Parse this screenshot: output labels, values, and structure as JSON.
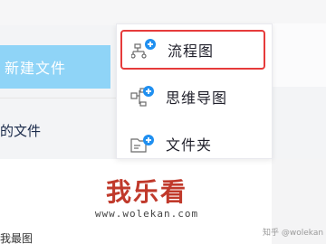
{
  "sidebar": {
    "new_file_label": "新建文件",
    "item_label": "的文件",
    "bottom_fragment": "我最图"
  },
  "dropdown": {
    "items": [
      {
        "label": "流程图",
        "icon": "flowchart-add-icon",
        "selected": true
      },
      {
        "label": "思维导图",
        "icon": "mindmap-add-icon",
        "selected": false
      },
      {
        "label": "文件夹",
        "icon": "folder-add-icon",
        "selected": false
      }
    ]
  },
  "watermark": {
    "title": "我乐看",
    "url": "www.wolekan.com",
    "corner": "知乎 @wolekan"
  },
  "colors": {
    "accent_blue": "#1f8ff0",
    "new_button_bg": "#8fd4f7",
    "selection_border": "#e63b3b",
    "watermark_red": "#c0392b"
  }
}
